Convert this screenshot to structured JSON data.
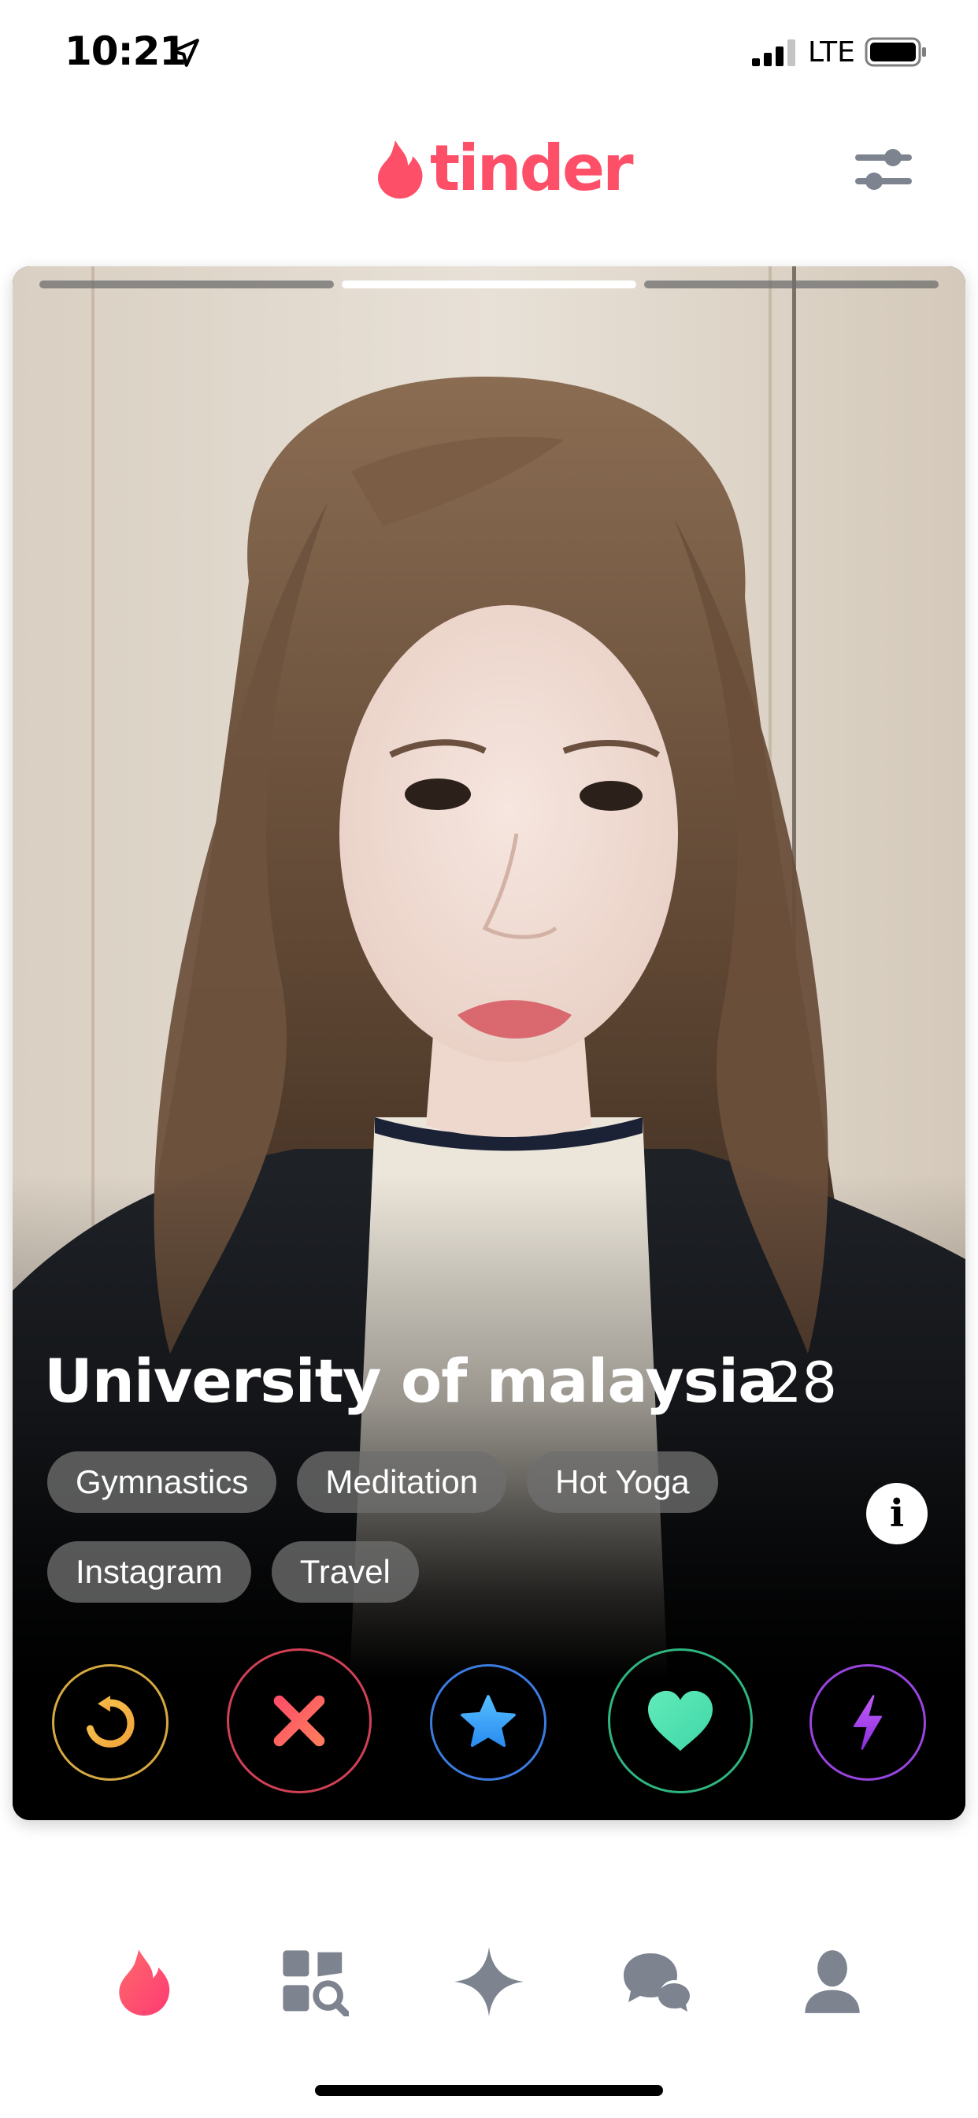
{
  "status_bar": {
    "time": "10:21",
    "network": "LTE",
    "icons": [
      "location-arrow-icon",
      "signal-icon",
      "battery-icon"
    ]
  },
  "header": {
    "logo_text": "tinder",
    "brand_color": "#fd5068",
    "filter_icon": "sliders-icon"
  },
  "card": {
    "photo_count": 3,
    "active_photo": 2,
    "name": "University of malaysia",
    "age": "28",
    "interests_row1": [
      "Gymnastics",
      "Meditation",
      "Hot Yoga"
    ],
    "interests_row2": [
      "Instagram",
      "Travel"
    ],
    "info_label": "i"
  },
  "actions": [
    {
      "name": "rewind",
      "icon": "rewind-icon",
      "color": "#f5b748"
    },
    {
      "name": "nope",
      "icon": "close-icon",
      "color": "#fd5068"
    },
    {
      "name": "super-like",
      "icon": "star-icon",
      "color": "#3ca4ff"
    },
    {
      "name": "like",
      "icon": "heart-icon",
      "color": "#4fe3b4"
    },
    {
      "name": "boost",
      "icon": "lightning-icon",
      "color": "#b14cf0"
    }
  ],
  "bottom_nav": {
    "items": [
      {
        "name": "discover",
        "icon": "flame-icon",
        "active": true
      },
      {
        "name": "explore",
        "icon": "explore-grid-icon",
        "active": false
      },
      {
        "name": "gold",
        "icon": "sparkle-icon",
        "active": false
      },
      {
        "name": "messages",
        "icon": "chat-bubbles-icon",
        "active": false
      },
      {
        "name": "profile",
        "icon": "person-icon",
        "active": false
      }
    ],
    "inactive_color": "#7d8490"
  }
}
